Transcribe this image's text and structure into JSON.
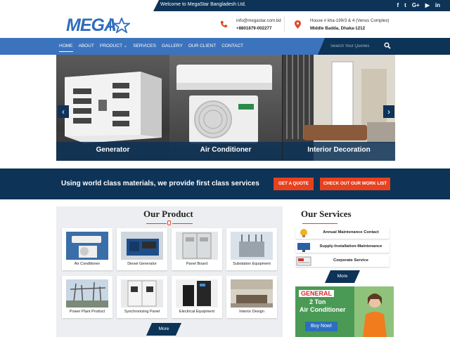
{
  "topbar": {
    "welcome": "Welcome to MegaStar Bangladesh Ltd.",
    "social": [
      {
        "icon": "facebook-icon",
        "glyph": "f"
      },
      {
        "icon": "twitter-icon",
        "glyph": "t"
      },
      {
        "icon": "google-plus-icon",
        "glyph": "G+"
      },
      {
        "icon": "youtube-icon",
        "glyph": "▶"
      },
      {
        "icon": "linkedin-icon",
        "glyph": "in"
      }
    ]
  },
  "header": {
    "logo_text": "MEGA",
    "email": "info@megastar.com.bd",
    "phone": "+8801879-002277",
    "address_line1": "House # kha-199/3 & 4 (Venus Complex)",
    "address_line2": "Middle Badda, Dhaka-1212"
  },
  "nav": {
    "items": [
      "HOME",
      "ABOUT",
      "PRODUCT",
      "SERVICES",
      "GALLERY",
      "OUR CLIENT",
      "CONTACT"
    ],
    "search_placeholder": "Search Your Queries"
  },
  "slider": {
    "captions": [
      "Generator",
      "Air Conditioner",
      "Interior Decoration"
    ],
    "prev": "‹",
    "next": "›"
  },
  "banner": {
    "text": "Using world class materials, we provide first class services",
    "quote_button": "GET A QUOTE",
    "work_button": "CHECK OUT OUR WORK LIST"
  },
  "products": {
    "title": "Our Product",
    "items": [
      "Air Conditioner",
      "Diesel Generator",
      "Panel Board",
      "Substation Equipment",
      "Power Plant Product",
      "Synchronizing Panel",
      "Electrical Equipment",
      "Interior Design"
    ],
    "more": "More"
  },
  "services": {
    "title": "Our Services",
    "items": [
      "Annual Maintenance Contact",
      "Supply-Installation-Maintenance",
      "Corporate Service"
    ],
    "more": "More"
  },
  "ad": {
    "brand": "GENERAL",
    "line1": "2 Ton",
    "line2": "Air Conditioner",
    "button": "Buy Now!"
  },
  "colors": {
    "navy": "#0d3357",
    "nav_blue": "#3b73bd",
    "accent_red": "#e8411f",
    "logo_blue": "#2f6dbe"
  }
}
